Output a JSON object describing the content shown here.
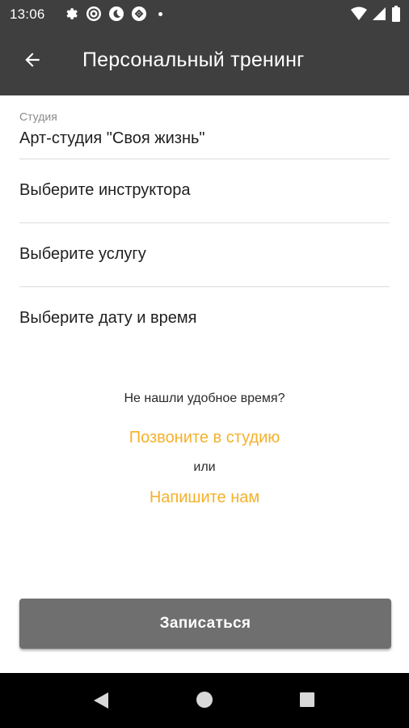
{
  "status_bar": {
    "time": "13:06",
    "icons_left": [
      "gear-icon",
      "vpn-icon",
      "moon-icon",
      "vpn-key-icon"
    ],
    "icons_right": [
      "wifi-icon",
      "signal-icon",
      "battery-icon"
    ]
  },
  "app_bar": {
    "title": "Персональный тренинг",
    "back_icon": "arrow-back-icon"
  },
  "form": {
    "studio_label": "Студия",
    "studio_value": "Арт-студия \"Своя жизнь\"",
    "instructor_placeholder": "Выберите инструктора",
    "service_placeholder": "Выберите услугу",
    "datetime_placeholder": "Выберите дату и время"
  },
  "help": {
    "question": "Не нашли удобное время?",
    "call_link": "Позвоните в студию",
    "or": "или",
    "write_link": "Напишите нам",
    "link_color": "#f5b12b"
  },
  "submit": {
    "label": "Записаться",
    "color": "#6f6f6f"
  },
  "nav_bar": {
    "icons": [
      "nav-back-icon",
      "nav-home-icon",
      "nav-recents-icon"
    ]
  },
  "colors": {
    "toolbar": "#3f3f3f"
  }
}
